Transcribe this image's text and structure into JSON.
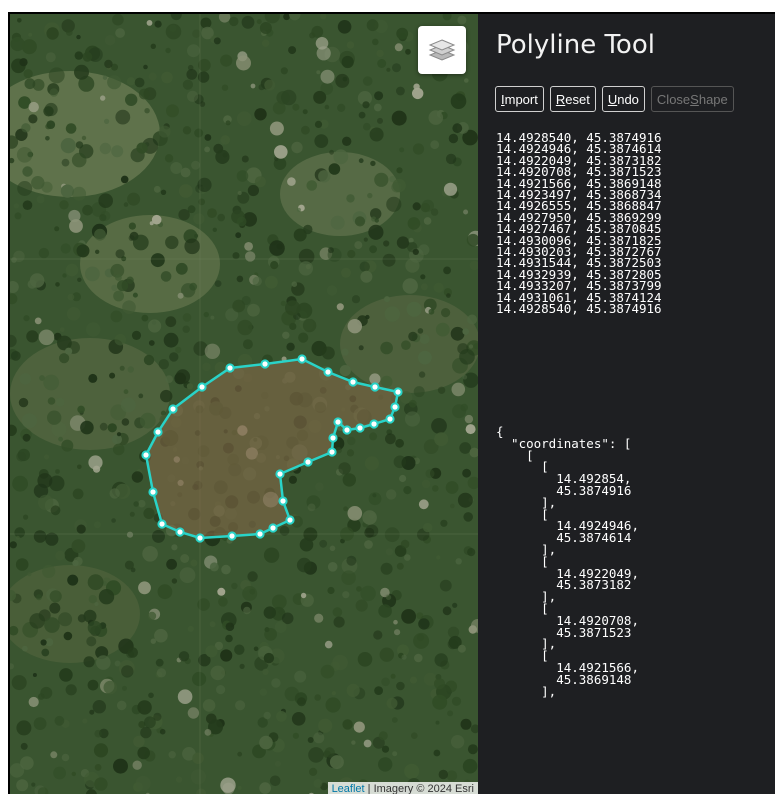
{
  "map": {
    "attribution_link": "Leaflet",
    "attribution_text": " | Imagery © 2024 Esri",
    "layers_icon": "layers-icon",
    "polygon_color": "#29d3c8"
  },
  "panel": {
    "title": "Polyline Tool",
    "buttons": [
      {
        "pre": "",
        "key": "I",
        "post": "mport",
        "enabled": true
      },
      {
        "pre": "",
        "key": "R",
        "post": "eset",
        "enabled": true
      },
      {
        "pre": "",
        "key": "U",
        "post": "ndo",
        "enabled": true
      },
      {
        "pre": "Close ",
        "key": "S",
        "post": "hape",
        "enabled": false
      }
    ],
    "coordinate_lines": [
      "14.4928540, 45.3874916",
      "14.4924946, 45.3874614",
      "14.4922049, 45.3873182",
      "14.4920708, 45.3871523",
      "14.4921566, 45.3869148",
      "14.4923497, 45.3868734",
      "14.4926555, 45.3868847",
      "14.4927950, 45.3869299",
      "14.4927467, 45.3870845",
      "14.4930096, 45.3871825",
      "14.4930203, 45.3872767",
      "14.4931544, 45.3872503",
      "14.4932939, 45.3872805",
      "14.4933207, 45.3873799",
      "14.4931061, 45.3874124",
      "14.4928540, 45.3874916"
    ],
    "json_text": "{\n  \"coordinates\": [\n    [\n      [\n        14.492854,\n        45.3874916\n      ],\n      [\n        14.4924946,\n        45.3874614\n      ],\n      [\n        14.4922049,\n        45.3873182\n      ],\n      [\n        14.4920708,\n        45.3871523\n      ],\n      [\n        14.4921566,\n        45.3869148\n      ],"
  }
}
